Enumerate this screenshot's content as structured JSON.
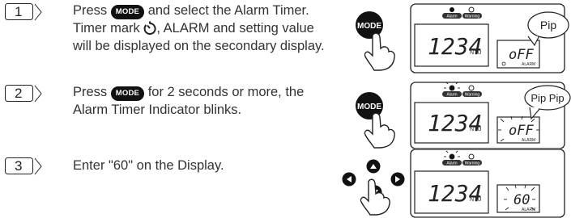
{
  "steps": [
    {
      "number": "1",
      "text_a": "Press",
      "mode_label": "MODE",
      "text_b": "and select the Alarm Timer.",
      "text_c": "Timer mark",
      "text_d": ", ALARM and setting value",
      "text_e": "will be displayed on the secondary display.",
      "button_label": "MODE",
      "display": {
        "main_value": "1234",
        "unit": "NTU",
        "secondary_value": "oFF",
        "alarm_tag": "ALARM",
        "indicator_1": "Alarm",
        "indicator_2": "Warning"
      },
      "sound": "Pip"
    },
    {
      "number": "2",
      "text_a": "Press",
      "mode_label": "MODE",
      "text_b": "for 2 seconds or more, the",
      "text_c": "Alarm Timer Indicator blinks.",
      "button_label": "MODE",
      "display": {
        "main_value": "1234",
        "unit": "NTU",
        "secondary_value": "oFF",
        "alarm_tag": "ALARM",
        "indicator_1": "Alarm",
        "indicator_2": "Warning"
      },
      "sound": "Pip Pip"
    },
    {
      "number": "3",
      "text_a": "Enter \"60\" on the Display.",
      "display": {
        "main_value": "1234",
        "unit": "NTU",
        "secondary_value": "60",
        "alarm_tag": "ALARM",
        "indicator_1": "Alarm",
        "indicator_2": "Warning"
      }
    }
  ],
  "colors": {
    "ink": "#1a1a1a",
    "pill": "#111111"
  }
}
